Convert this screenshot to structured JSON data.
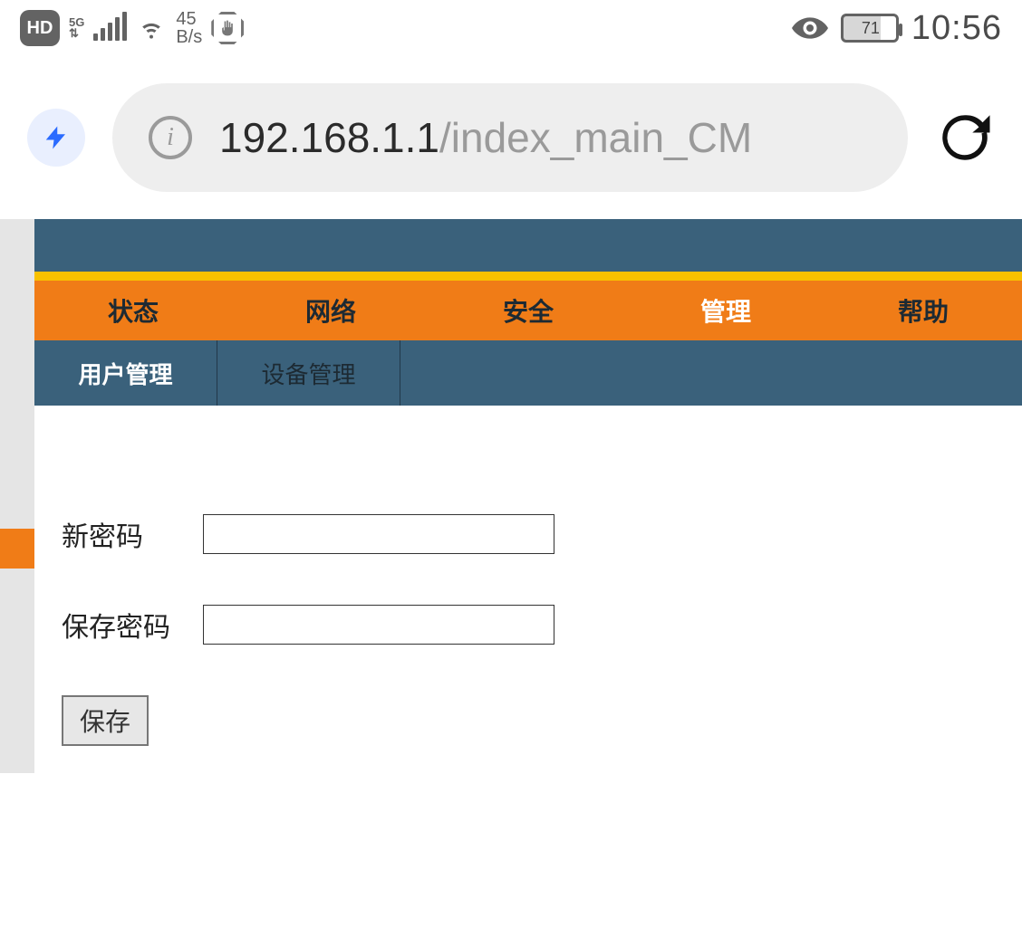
{
  "status_bar": {
    "hd": "HD",
    "network_type": "5G",
    "speed_value": "45",
    "speed_unit": "B/s",
    "battery_percent": "71",
    "clock": "10:56"
  },
  "browser": {
    "url_host": "192.168.1.1",
    "url_path": "/index_main_CM"
  },
  "main_tabs": [
    {
      "label": "状态",
      "active": false
    },
    {
      "label": "网络",
      "active": false
    },
    {
      "label": "安全",
      "active": false
    },
    {
      "label": "管理",
      "active": true
    },
    {
      "label": "帮助",
      "active": false
    }
  ],
  "sub_tabs": [
    {
      "label": "用户管理",
      "active": true
    },
    {
      "label": "设备管理",
      "active": false
    }
  ],
  "form": {
    "new_password_label": "新密码",
    "confirm_password_label": "保存密码",
    "new_password_value": "",
    "confirm_password_value": "",
    "save_button": "保存"
  }
}
